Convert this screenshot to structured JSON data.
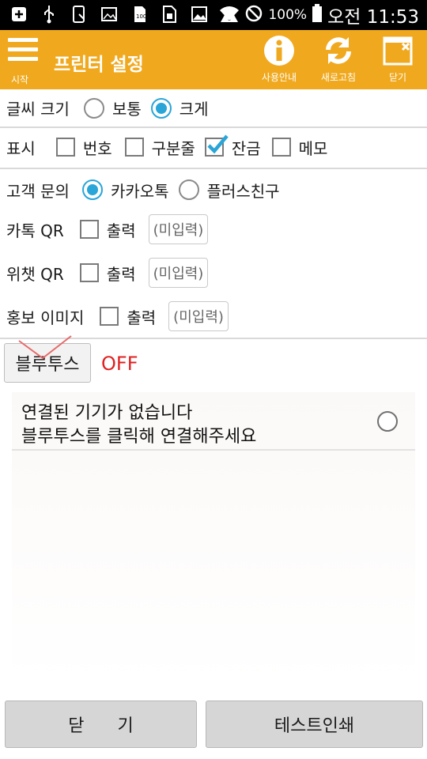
{
  "status_bar": {
    "left_icons": [
      "add-box-icon",
      "usb-icon",
      "phone-icon",
      "photo-icon",
      "sd-card-icon",
      "sim-icon",
      "image-icon",
      "warning-icon"
    ],
    "right_icons": [
      "wifi-icon",
      "blocked-icon",
      "battery-icon"
    ],
    "battery": "100%",
    "time": "오전 11:53"
  },
  "app_bar": {
    "menu_label": "시작",
    "title": "프린터 설정",
    "help_label": "사용안내",
    "refresh_label": "새로고침",
    "close_label": "닫기",
    "color": "#f0a91e"
  },
  "font_size": {
    "label": "글씨 크기",
    "options": [
      {
        "label": "보통",
        "selected": false
      },
      {
        "label": "크게",
        "selected": true
      }
    ]
  },
  "display": {
    "label": "표시",
    "options": [
      {
        "label": "번호",
        "checked": false
      },
      {
        "label": "구분줄",
        "checked": false
      },
      {
        "label": "잔금",
        "checked": true
      },
      {
        "label": "메모",
        "checked": false
      }
    ]
  },
  "customer_inquiry": {
    "label": "고객 문의",
    "options": [
      {
        "label": "카카오톡",
        "selected": true
      },
      {
        "label": "플러스친구",
        "selected": false
      }
    ]
  },
  "kakao_qr": {
    "label": "카톡 QR",
    "option": "출력",
    "checked": false,
    "value": "(미입력)"
  },
  "wechat_qr": {
    "label": "위챗 QR",
    "option": "출력",
    "checked": false,
    "value": "(미입력)"
  },
  "promo_image": {
    "label": "홍보 이미지",
    "option": "출력",
    "checked": false,
    "value": "(미입력)"
  },
  "bluetooth": {
    "button_label": "블루투스",
    "status": "OFF",
    "status_color": "#e02020"
  },
  "device_list": {
    "line1": "연결된 기기가 없습니다",
    "line2": "블루투스를 클릭해 연결해주세요"
  },
  "buttons": {
    "close": "닫      기",
    "test_print": "테스트인쇄"
  }
}
